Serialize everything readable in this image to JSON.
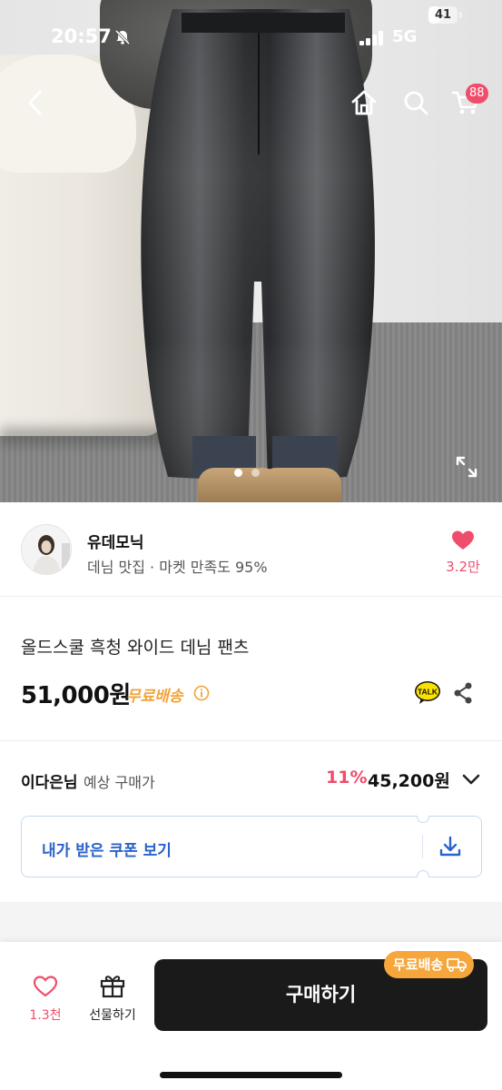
{
  "status_bar": {
    "time": "20:57",
    "network": "5G",
    "battery": "41",
    "battery_level": 0.41
  },
  "nav": {
    "back_icon": "chevron-left-icon",
    "home_icon": "home-icon",
    "search_icon": "search-icon",
    "cart_icon": "cart-icon",
    "cart_badge": "88"
  },
  "gallery": {
    "image_count": 2,
    "current_index": 0,
    "expand_icon": "expand-icon"
  },
  "seller": {
    "name": "유데모닉",
    "subtitle": "데님 맛집 · 마켓 만족도 95%",
    "like_count": "3.2만"
  },
  "product": {
    "title": "올드스쿨 흑청 와이드 데님 팬츠",
    "price": "51,000원",
    "shipping": "무료배송"
  },
  "member_price": {
    "name": "이다은님",
    "label": "예상 구매가",
    "discount": "11%",
    "price": "45,200원"
  },
  "coupon": {
    "label": "내가 받은 쿠폰 보기"
  },
  "bottom_bar": {
    "wish_count": "1.3천",
    "gift_label": "선물하기",
    "buy_label": "구매하기",
    "badge": "무료배송"
  },
  "colors": {
    "accent_pink": "#ef4d6b",
    "shipping_orange": "#f2a33a",
    "coupon_blue": "#2a63c9",
    "buy_button": "#1a1a1a"
  }
}
